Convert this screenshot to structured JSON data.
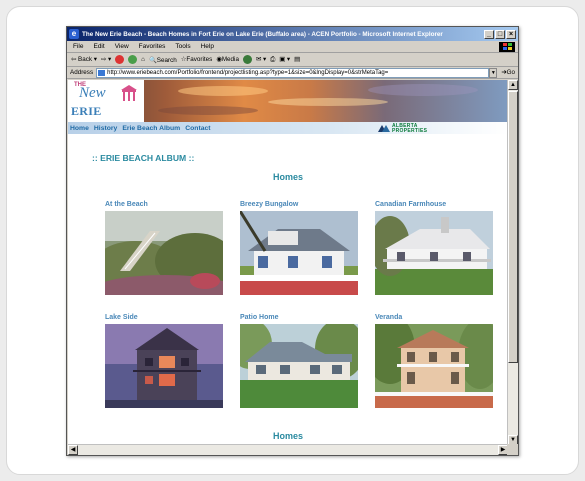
{
  "window": {
    "title": "The New Erie Beach - Beach Homes in Fort Erie on Lake Erie (Buffalo area) - ACEN Portfolio - Microsoft Internet Explorer",
    "controls": [
      "_",
      "□",
      "×"
    ]
  },
  "menu": [
    "File",
    "Edit",
    "View",
    "Favorites",
    "Tools",
    "Help"
  ],
  "toolbar": {
    "back": "Back",
    "search": "Search",
    "favorites": "Favorites",
    "media": "Media"
  },
  "address": {
    "label": "Address",
    "url": "http://www.eriebeach.com/Portfolio/frontend/projectlisting.asp?type=1&size=0&lngDisplay=0&strMetaTag=",
    "go": "Go"
  },
  "site": {
    "logo_the": "THE",
    "logo_new": "New",
    "logo_beach": "ERIE BEACH",
    "nav": [
      "Home",
      "History",
      "Erie Beach Album",
      "Contact"
    ],
    "partner_line1": "ALBERTA",
    "partner_line2": "PROPERTIES",
    "album_title": ":: ERIE BEACH ALBUM ::",
    "section_heading": "Homes",
    "section_heading_bottom": "Homes",
    "homes": [
      {
        "name": "At the Beach"
      },
      {
        "name": "Breezy Bungalow"
      },
      {
        "name": "Canadian Farmhouse"
      },
      {
        "name": "Lake Side"
      },
      {
        "name": "Patio Home"
      },
      {
        "name": "Veranda"
      }
    ]
  },
  "colors": {
    "accent": "#2a8aa0",
    "link": "#1f6aa5",
    "caption": "#4a88b8",
    "titlebar": "#0a246a"
  }
}
